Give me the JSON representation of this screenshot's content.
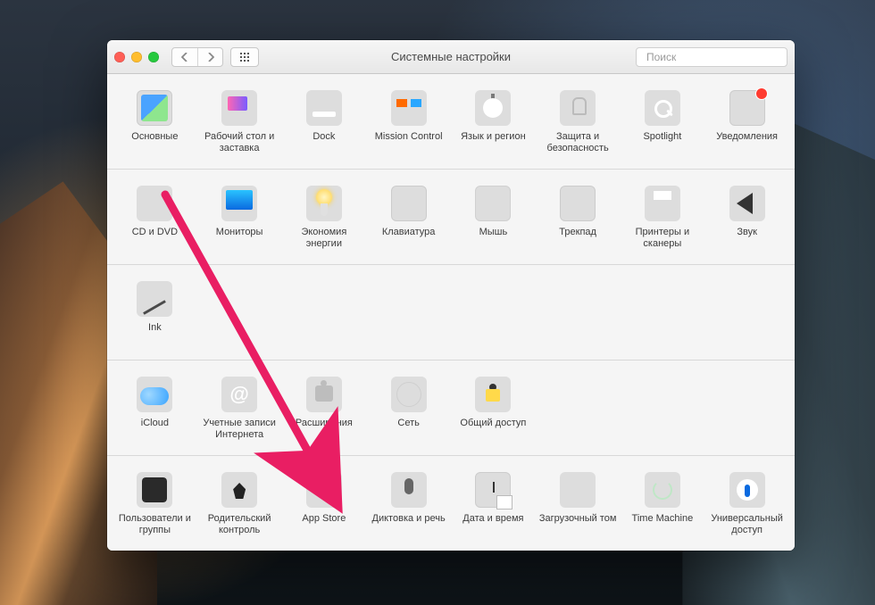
{
  "window": {
    "title": "Системные настройки",
    "search_placeholder": "Поиск"
  },
  "sections": [
    {
      "items": [
        {
          "key": "general",
          "label": "Основные",
          "icon": "ic-general"
        },
        {
          "key": "desktop",
          "label": "Рабочий стол и заставка",
          "icon": "ic-desktop"
        },
        {
          "key": "dock",
          "label": "Dock",
          "icon": "ic-dock"
        },
        {
          "key": "mission",
          "label": "Mission Control",
          "icon": "ic-mission"
        },
        {
          "key": "language",
          "label": "Язык и регион",
          "icon": "ic-lang"
        },
        {
          "key": "security",
          "label": "Защита и безопасность",
          "icon": "ic-security"
        },
        {
          "key": "spotlight",
          "label": "Spotlight",
          "icon": "ic-spotlight"
        },
        {
          "key": "notifications",
          "label": "Уведомления",
          "icon": "ic-notify"
        }
      ]
    },
    {
      "items": [
        {
          "key": "cddvd",
          "label": "CD и DVD",
          "icon": "ic-cd"
        },
        {
          "key": "displays",
          "label": "Мониторы",
          "icon": "ic-display"
        },
        {
          "key": "energy",
          "label": "Экономия энергии",
          "icon": "ic-energy"
        },
        {
          "key": "keyboard",
          "label": "Клавиатура",
          "icon": "ic-keyboard"
        },
        {
          "key": "mouse",
          "label": "Мышь",
          "icon": "ic-mouse"
        },
        {
          "key": "trackpad",
          "label": "Трекпад",
          "icon": "ic-trackpad"
        },
        {
          "key": "printers",
          "label": "Принтеры и сканеры",
          "icon": "ic-printer"
        },
        {
          "key": "sound",
          "label": "Звук",
          "icon": "ic-sound"
        }
      ]
    },
    {
      "items": [
        {
          "key": "ink",
          "label": "Ink",
          "icon": "ic-ink"
        }
      ]
    },
    {
      "items": [
        {
          "key": "icloud",
          "label": "iCloud",
          "icon": "ic-icloud"
        },
        {
          "key": "internet",
          "label": "Учетные записи Интернета",
          "icon": "ic-internet"
        },
        {
          "key": "extensions",
          "label": "Расширения",
          "icon": "ic-extensions"
        },
        {
          "key": "network",
          "label": "Сеть",
          "icon": "ic-network"
        },
        {
          "key": "sharing",
          "label": "Общий доступ",
          "icon": "ic-sharing"
        }
      ]
    },
    {
      "items": [
        {
          "key": "users",
          "label": "Пользователи и группы",
          "icon": "ic-users"
        },
        {
          "key": "parental",
          "label": "Родительский контроль",
          "icon": "ic-parental"
        },
        {
          "key": "appstore",
          "label": "App Store",
          "icon": "ic-appstore"
        },
        {
          "key": "dictation",
          "label": "Диктовка и речь",
          "icon": "ic-dictation"
        },
        {
          "key": "datetime",
          "label": "Дата и время",
          "icon": "ic-datetime"
        },
        {
          "key": "startup",
          "label": "Загрузочный том",
          "icon": "ic-startup"
        },
        {
          "key": "timemachine",
          "label": "Time Machine",
          "icon": "ic-timemachine"
        },
        {
          "key": "accessibility",
          "label": "Универсальный доступ",
          "icon": "ic-accessibility"
        }
      ]
    }
  ],
  "annotation": {
    "arrow_color": "#e91e63"
  }
}
